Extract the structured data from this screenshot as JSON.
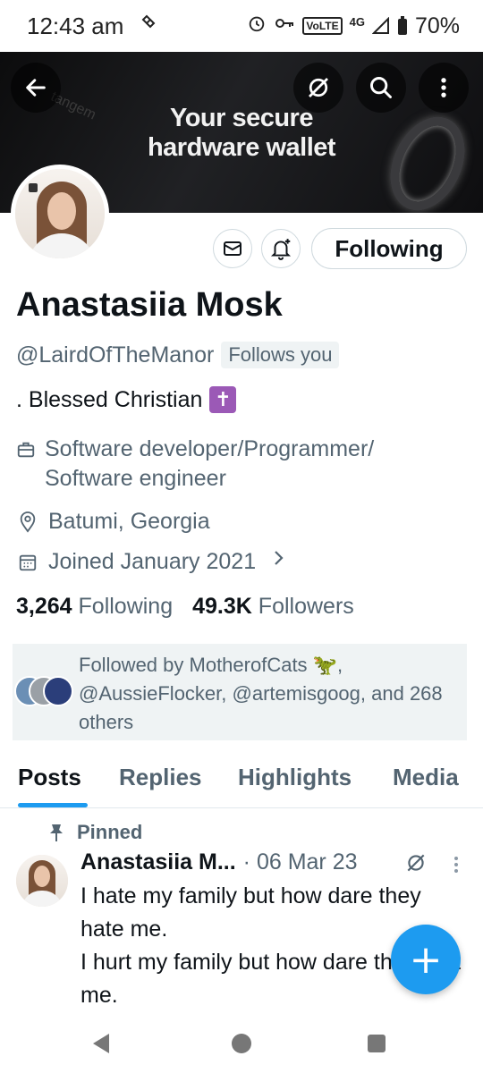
{
  "status_bar": {
    "time": "12:43 am",
    "volte": "VoLTE",
    "network": "4G",
    "battery": "70%"
  },
  "banner": {
    "line1": "Your secure",
    "line2": "hardware wallet",
    "faint": "tangem"
  },
  "profile": {
    "display_name": "Anastasiia Mosk",
    "handle": "@LairdOfTheManor",
    "follows_you": "Follows you",
    "bio": ". Blessed Christian",
    "bio_emoji": "✝",
    "profession": "Software developer/Programmer/ Software engineer",
    "location": "Batumi, Georgia",
    "joined": "Joined January 2021",
    "following_label": "Following",
    "following_count": "3,264",
    "following_text": "Following",
    "followers_count": "49.3K",
    "followers_text": "Followers"
  },
  "followed_by": {
    "text": "Followed by MotherofCats 🦖, @AussieFlocker, @artemisgoog, and 268 others"
  },
  "tabs": [
    {
      "label": "Posts"
    },
    {
      "label": "Replies"
    },
    {
      "label": "Highlights"
    },
    {
      "label": "Media"
    }
  ],
  "post": {
    "pinned_label": "Pinned",
    "author": "Anastasiia M...",
    "date": "· 06 Mar 23",
    "text": "I hate my family but how dare they hate me.\nI hurt my family but how dare they hurt me."
  },
  "fab": {
    "label": "+"
  },
  "colors": {
    "accent": "#1d9bf0",
    "text_primary": "#0f1419",
    "text_secondary": "#536471"
  }
}
